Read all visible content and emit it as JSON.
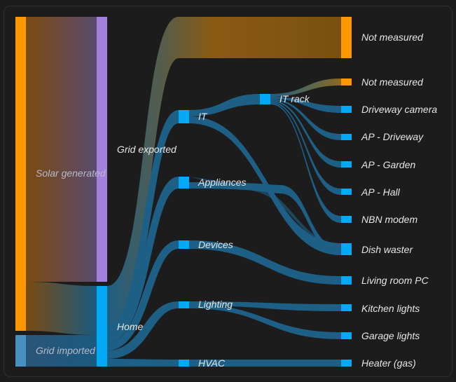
{
  "colors": {
    "background": "#1c1c1c",
    "solar": "#ff9800",
    "grid_import": "#488fc2",
    "grid_export": "#a280db",
    "home": "#03a9f4",
    "not_measured": "#ff9800",
    "link_blue": "#1e5f86",
    "link_orange": "#a8660f"
  },
  "nodes": {
    "solar_generated": "Solar generated",
    "grid_imported": "Grid imported",
    "grid_exported": "Grid exported",
    "home": "Home",
    "not_measured_top": "Not measured",
    "it": "IT",
    "appliances": "Appliances",
    "devices": "Devices",
    "lighting": "Lighting",
    "hvac": "HVAC",
    "it_rack": "IT rack",
    "not_measured_rack": "Not measured",
    "driveway_camera": "Driveway camera",
    "ap_driveway": "AP - Driveway",
    "ap_garden": "AP - Garden",
    "ap_hall": "AP - Hall",
    "nbn_modem": "NBN modem",
    "dish_waster": "Dish waster",
    "living_room_pc": "Living room PC",
    "kitchen_lights": "Kitchen lights",
    "garage_lights": "Garage lights",
    "heater_gas": "Heater (gas)"
  }
}
